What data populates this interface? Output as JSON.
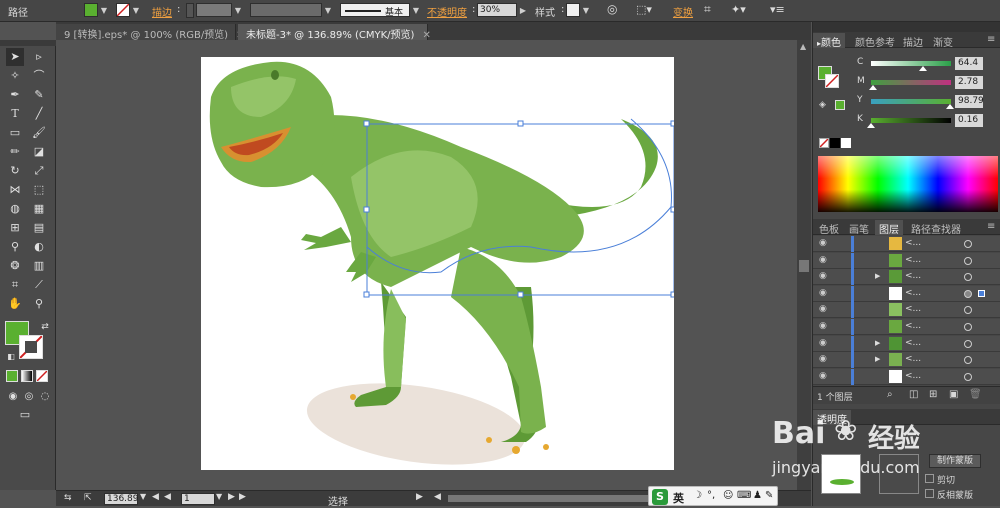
{
  "control_bar": {
    "object_type": "路径",
    "stroke_label": "描边",
    "brush_label": "基本",
    "opacity_label": "不透明度",
    "opacity_value": "30%",
    "style_label": "样式",
    "transform_label": "变换"
  },
  "tabs": [
    {
      "label": "9 [转换].eps* @ 100% (RGB/预览)",
      "active": false
    },
    {
      "label": "未标题-3* @ 136.89% (CMYK/预览)",
      "active": true
    }
  ],
  "status_bar": {
    "zoom": "136.89",
    "page": "1",
    "tool_status": "选择"
  },
  "color_panel": {
    "tabs": [
      "颜色",
      "颜色参考",
      "描边",
      "渐变"
    ],
    "sliders": [
      {
        "label": "C",
        "value": "64.4",
        "fraction": 0.644,
        "gradient": [
          "#ffffff",
          "#2aa048"
        ]
      },
      {
        "label": "M",
        "value": "2.78",
        "fraction": 0.03,
        "gradient": [
          "#40a040",
          "#c03080"
        ]
      },
      {
        "label": "Y",
        "value": "98.79",
        "fraction": 0.99,
        "gradient": [
          "#3aa0c0",
          "#5ab030"
        ]
      },
      {
        "label": "K",
        "value": "0.16",
        "fraction": 0.0,
        "gradient": [
          "#5ab030",
          "#000000"
        ]
      }
    ]
  },
  "layers_panel": {
    "tabs": [
      "色板",
      "画笔",
      "图层",
      "路径查找器"
    ],
    "rows": [
      {
        "name": "<...",
        "expand": false,
        "thumb": "#e6b840"
      },
      {
        "name": "<...",
        "expand": false,
        "thumb": "#6aa840"
      },
      {
        "name": "<...",
        "expand": true,
        "thumb": "#5a9a38"
      },
      {
        "name": "<...",
        "expand": false,
        "thumb": "#ffffff",
        "selected": true
      },
      {
        "name": "<...",
        "expand": false,
        "thumb": "#8ac060"
      },
      {
        "name": "<...",
        "expand": false,
        "thumb": "#6aa840"
      },
      {
        "name": "<...",
        "expand": true,
        "thumb": "#4f9434"
      },
      {
        "name": "<...",
        "expand": true,
        "thumb": "#7ab050"
      },
      {
        "name": "<...",
        "expand": false,
        "thumb": "#ffffff"
      }
    ],
    "footer": "1 个图层"
  },
  "transparency_panel": {
    "title": "透明度",
    "mask_button": "制作蒙版",
    "clip_label": "剪切",
    "invert_label": "反相蒙版"
  },
  "watermark": {
    "brand": "Bai",
    "brand2": "经验",
    "url": "jingyan.baidu.com"
  },
  "ime_bar": {
    "label": "英"
  },
  "colors": {
    "fill": "#5ab030",
    "dino_main": "#7ab24d",
    "dino_dark": "#5e9a36",
    "dino_light": "#94c468",
    "shadow": "#ebe2da",
    "selection": "#4a7fd8"
  }
}
